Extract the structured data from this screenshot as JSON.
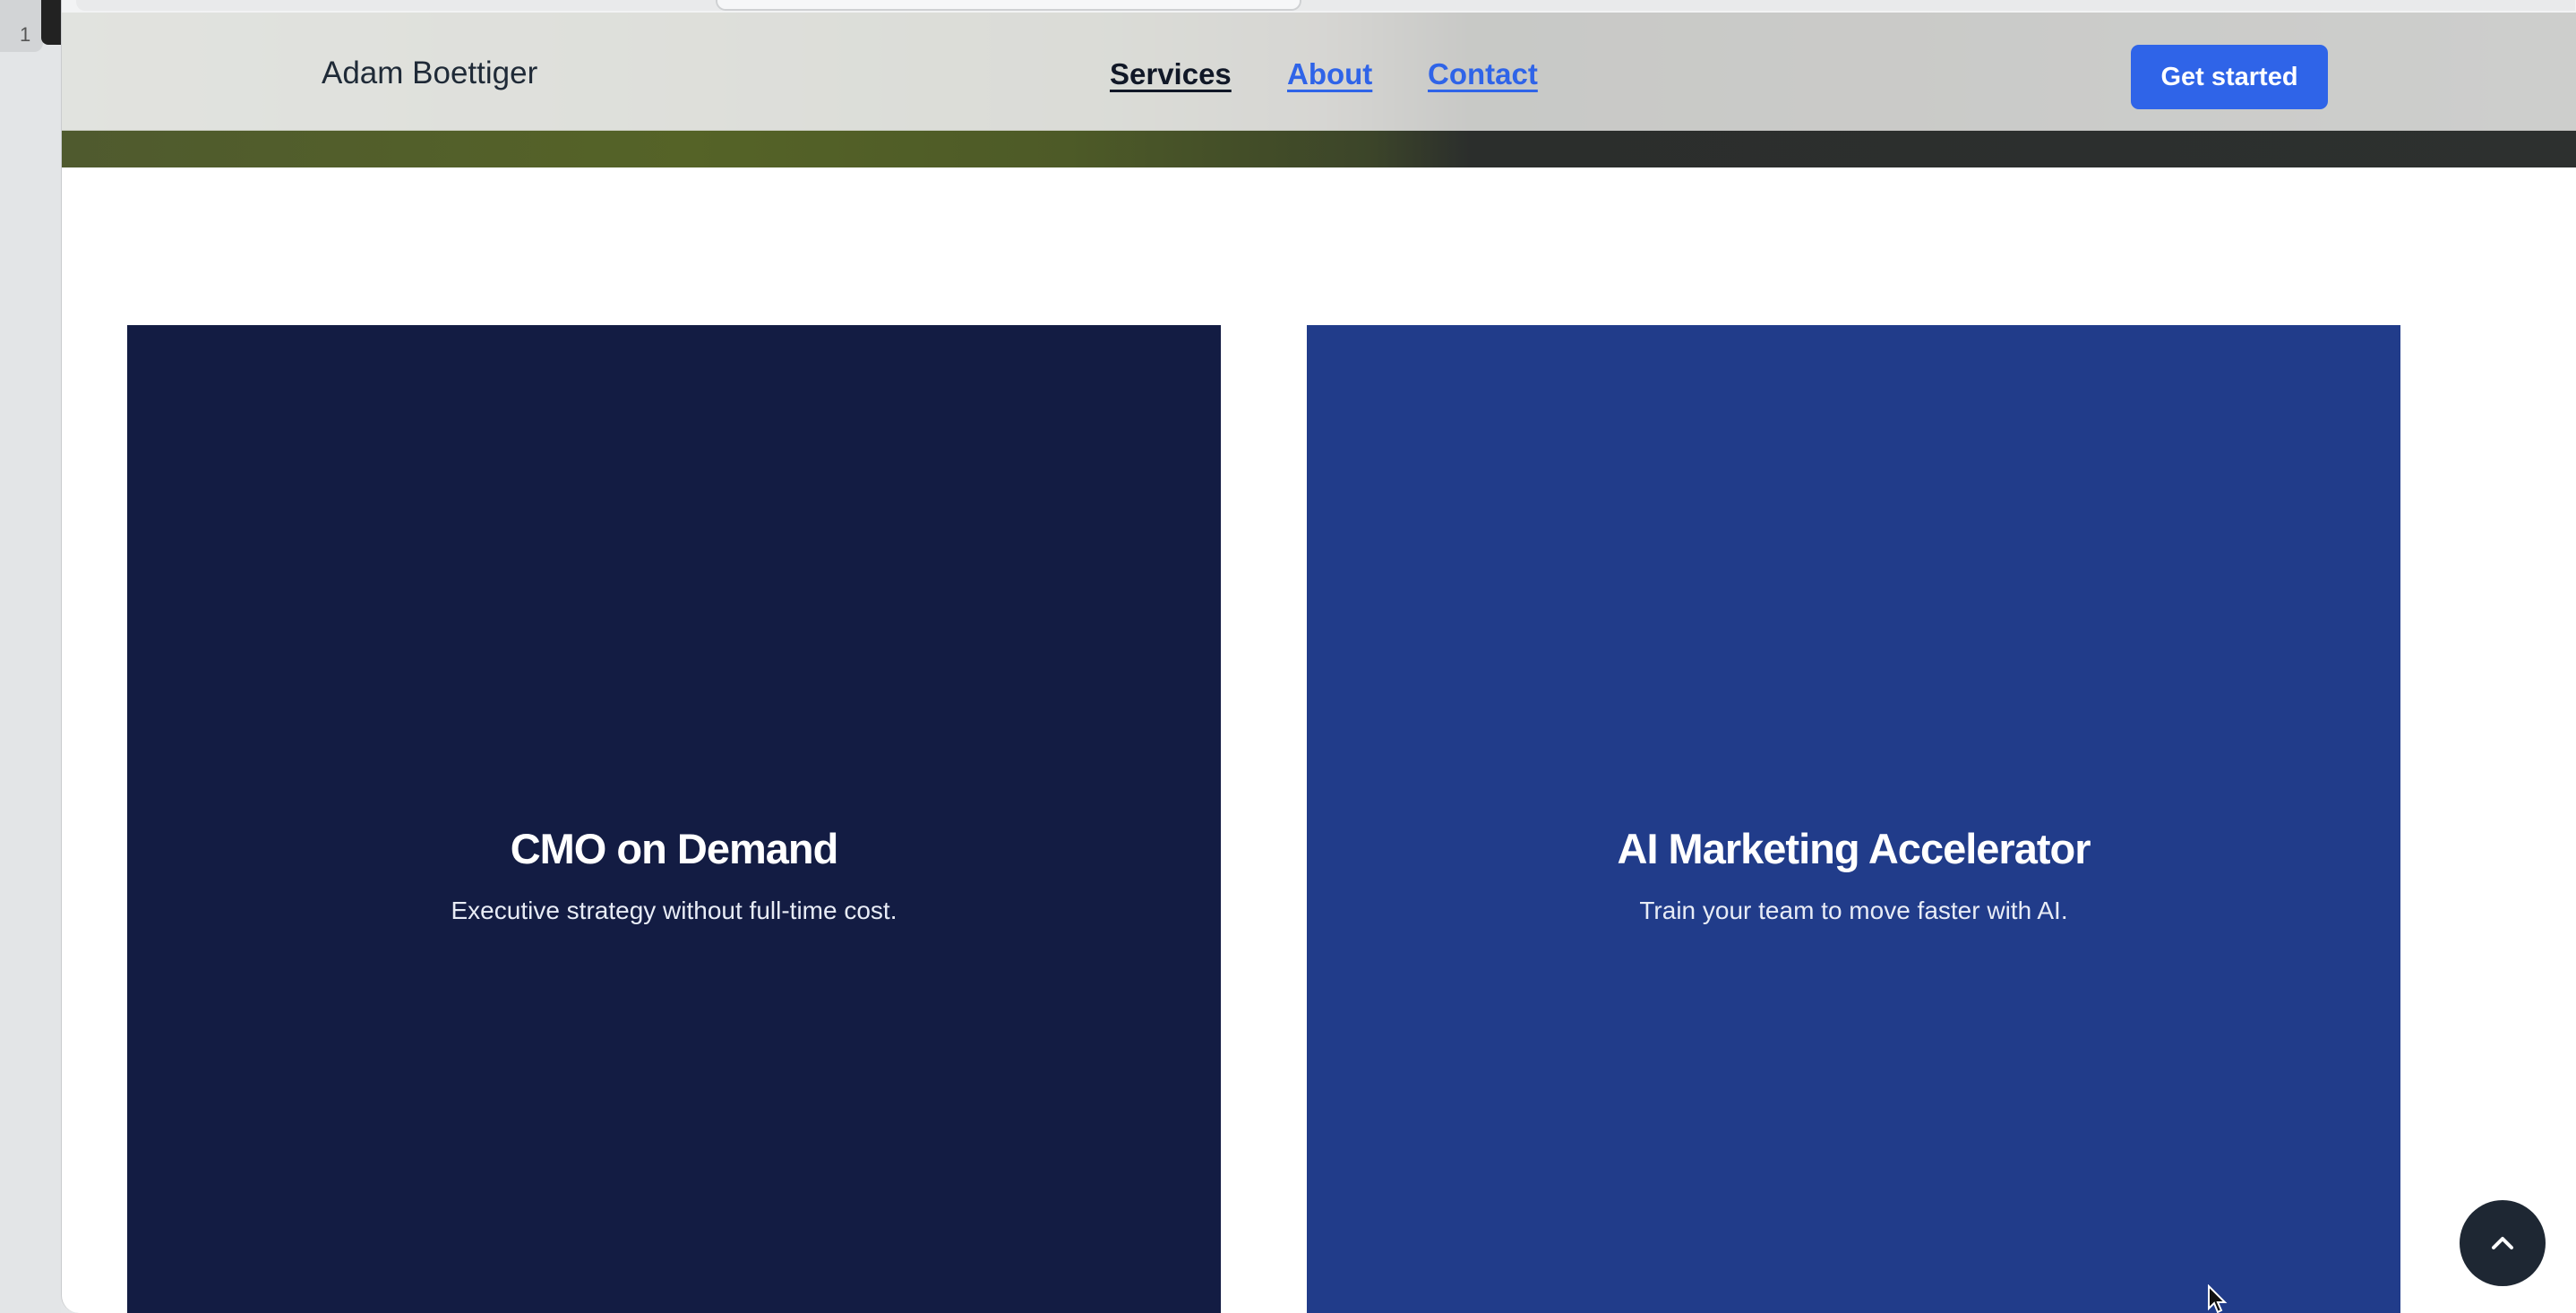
{
  "gutter": {
    "line_number": "1"
  },
  "header": {
    "logo": "Adam Boettiger",
    "nav": {
      "services": "Services",
      "about": "About",
      "contact": "Contact"
    },
    "cta": "Get started"
  },
  "cards": [
    {
      "title": "CMO on Demand",
      "description": "Executive strategy without full-time cost.",
      "color": "#131c43"
    },
    {
      "title": "AI Marketing Accelerator",
      "description": "Train your team to move faster with AI.",
      "color": "#213c8a"
    }
  ],
  "scroll_top": {
    "icon": "chevron-up-icon"
  },
  "colors": {
    "accent": "#2f64e8",
    "nav_active": "#111827"
  }
}
